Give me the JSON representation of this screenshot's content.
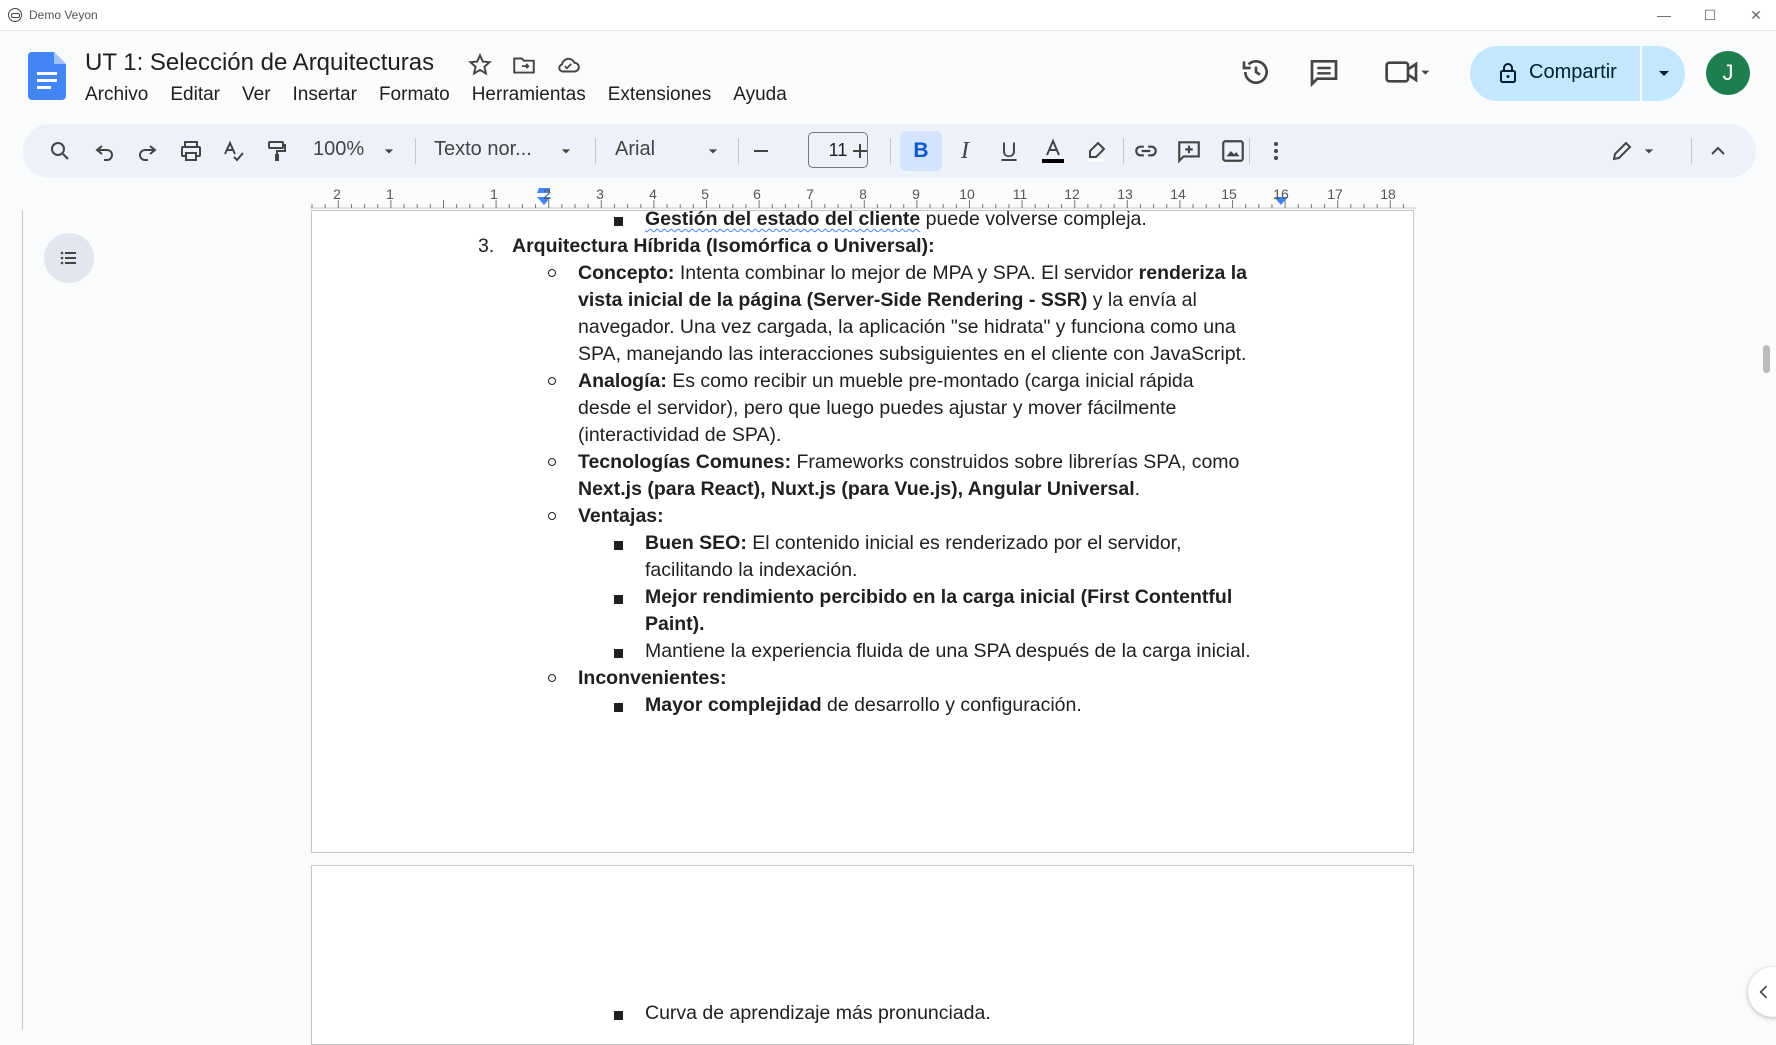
{
  "window": {
    "title": "Demo Veyon"
  },
  "doc": {
    "title": "UT 1: Selección de Arquitecturas"
  },
  "menu": [
    "Archivo",
    "Editar",
    "Ver",
    "Insertar",
    "Formato",
    "Herramientas",
    "Extensiones",
    "Ayuda"
  ],
  "share": {
    "label": "Compartir"
  },
  "avatar": {
    "initial": "J",
    "color": "#1e7e4e"
  },
  "toolbar": {
    "zoom": "100%",
    "style": "Texto nor...",
    "font": "Arial",
    "font_size": "11"
  },
  "ruler": {
    "numbers": [
      "2",
      "1",
      "1",
      "2",
      "3",
      "4",
      "5",
      "6",
      "7",
      "8",
      "9",
      "10",
      "11",
      "12",
      "13",
      "14",
      "15",
      "16",
      "17",
      "18"
    ]
  },
  "content": {
    "l1_bold": "Gestión del estado del cliente",
    "l1_rest": " puede volverse compleja.",
    "item3_num": "3.",
    "item3_title": "Arquitectura Híbrida (Isomórfica o Universal):",
    "concepto_label": "Concepto:",
    "concepto_t1": " Intenta combinar lo mejor de MPA y SPA. El servidor ",
    "concepto_b1": "renderiza la",
    "concepto_b2": "vista inicial de la página (Server-Side Rendering - SSR)",
    "concepto_t2": " y la envía al",
    "concepto_t3": "navegador. Una vez cargada, la aplicación \"se hidrata\" y funciona como una",
    "concepto_t4": "SPA, manejando las interacciones subsiguientes en el cliente con JavaScript.",
    "analogia_label": "Analogía:",
    "analogia_t1": " Es como recibir un mueble pre-montado (carga inicial rápida",
    "analogia_t2": "desde el servidor), pero que luego puedes ajustar y mover fácilmente",
    "analogia_t3": "(interactividad de SPA).",
    "tec_label": "Tecnologías Comunes:",
    "tec_t1": " Frameworks construidos sobre librerías SPA, como",
    "tec_b1": "Next.js (para React), Nuxt.js (para Vue.js), Angular Universal",
    "tec_t2": ".",
    "ventajas_label": "Ventajas:",
    "v1_label": "Buen SEO:",
    "v1_t1": " El contenido inicial es renderizado por el servidor,",
    "v1_t2": "facilitando la indexación.",
    "v2_b1": "Mejor rendimiento percibido en la carga inicial (First Contentful",
    "v2_b2": "Paint).",
    "v3": "Mantiene la experiencia fluida de una SPA después de la carga inicial.",
    "inconv_label": "Inconvenientes:",
    "i1_label": "Mayor complejidad",
    "i1_t1": " de desarrollo y configuración.",
    "i2": "Curva de aprendizaje más pronunciada."
  }
}
